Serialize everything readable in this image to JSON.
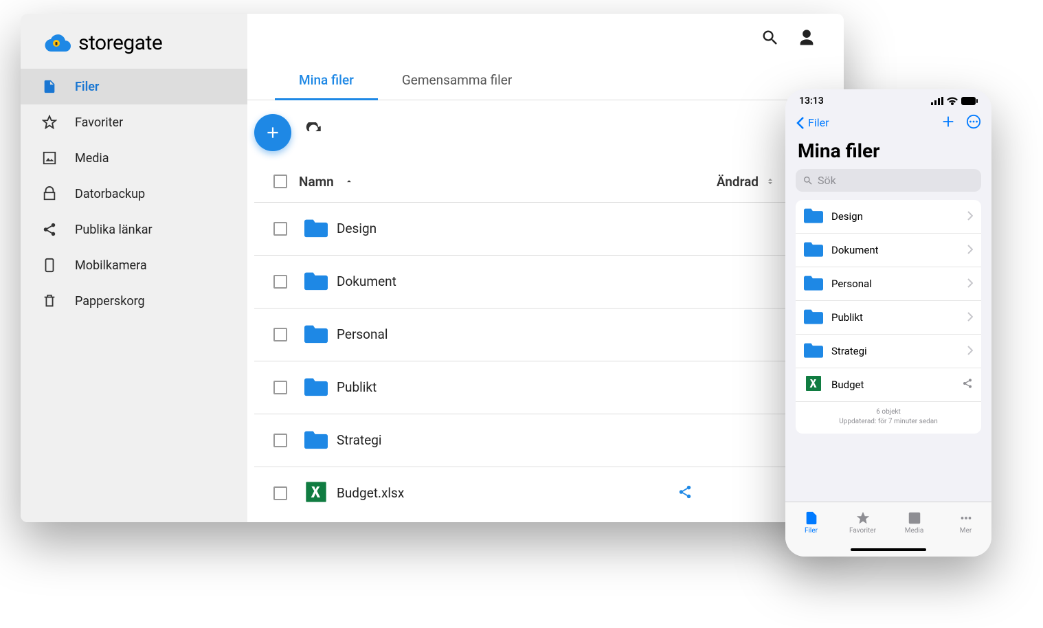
{
  "brand": "storegate",
  "sidebar": {
    "items": [
      {
        "label": "Filer",
        "icon": "file",
        "active": true
      },
      {
        "label": "Favoriter",
        "icon": "star",
        "active": false
      },
      {
        "label": "Media",
        "icon": "image",
        "active": false
      },
      {
        "label": "Datorbackup",
        "icon": "lock",
        "active": false
      },
      {
        "label": "Publika länkar",
        "icon": "share",
        "active": false
      },
      {
        "label": "Mobilkamera",
        "icon": "phone",
        "active": false
      },
      {
        "label": "Papperskorg",
        "icon": "trash",
        "active": false
      }
    ]
  },
  "tabs": [
    {
      "label": "Mina filer",
      "active": true
    },
    {
      "label": "Gemensamma filer",
      "active": false
    }
  ],
  "columns": {
    "name": "Namn",
    "modified": "Ändrad"
  },
  "files": [
    {
      "name": "Design",
      "type": "folder"
    },
    {
      "name": "Dokument",
      "type": "folder"
    },
    {
      "name": "Personal",
      "type": "folder"
    },
    {
      "name": "Publikt",
      "type": "folder"
    },
    {
      "name": "Strategi",
      "type": "folder"
    },
    {
      "name": "Budget.xlsx",
      "type": "excel",
      "shared": true
    }
  ],
  "mobile": {
    "time": "13:13",
    "back": "Filer",
    "title": "Mina filer",
    "search_placeholder": "Sök",
    "files": [
      {
        "name": "Design",
        "type": "folder"
      },
      {
        "name": "Dokument",
        "type": "folder"
      },
      {
        "name": "Personal",
        "type": "folder"
      },
      {
        "name": "Publikt",
        "type": "folder"
      },
      {
        "name": "Strategi",
        "type": "folder"
      },
      {
        "name": "Budget",
        "type": "excel",
        "shared": true
      }
    ],
    "meta_count": "6 objekt",
    "meta_updated": "Uppdaterad: för 7 minuter sedan",
    "tabs": [
      {
        "label": "Filer",
        "active": true
      },
      {
        "label": "Favoriter",
        "active": false
      },
      {
        "label": "Media",
        "active": false
      },
      {
        "label": "Mer",
        "active": false
      }
    ]
  }
}
